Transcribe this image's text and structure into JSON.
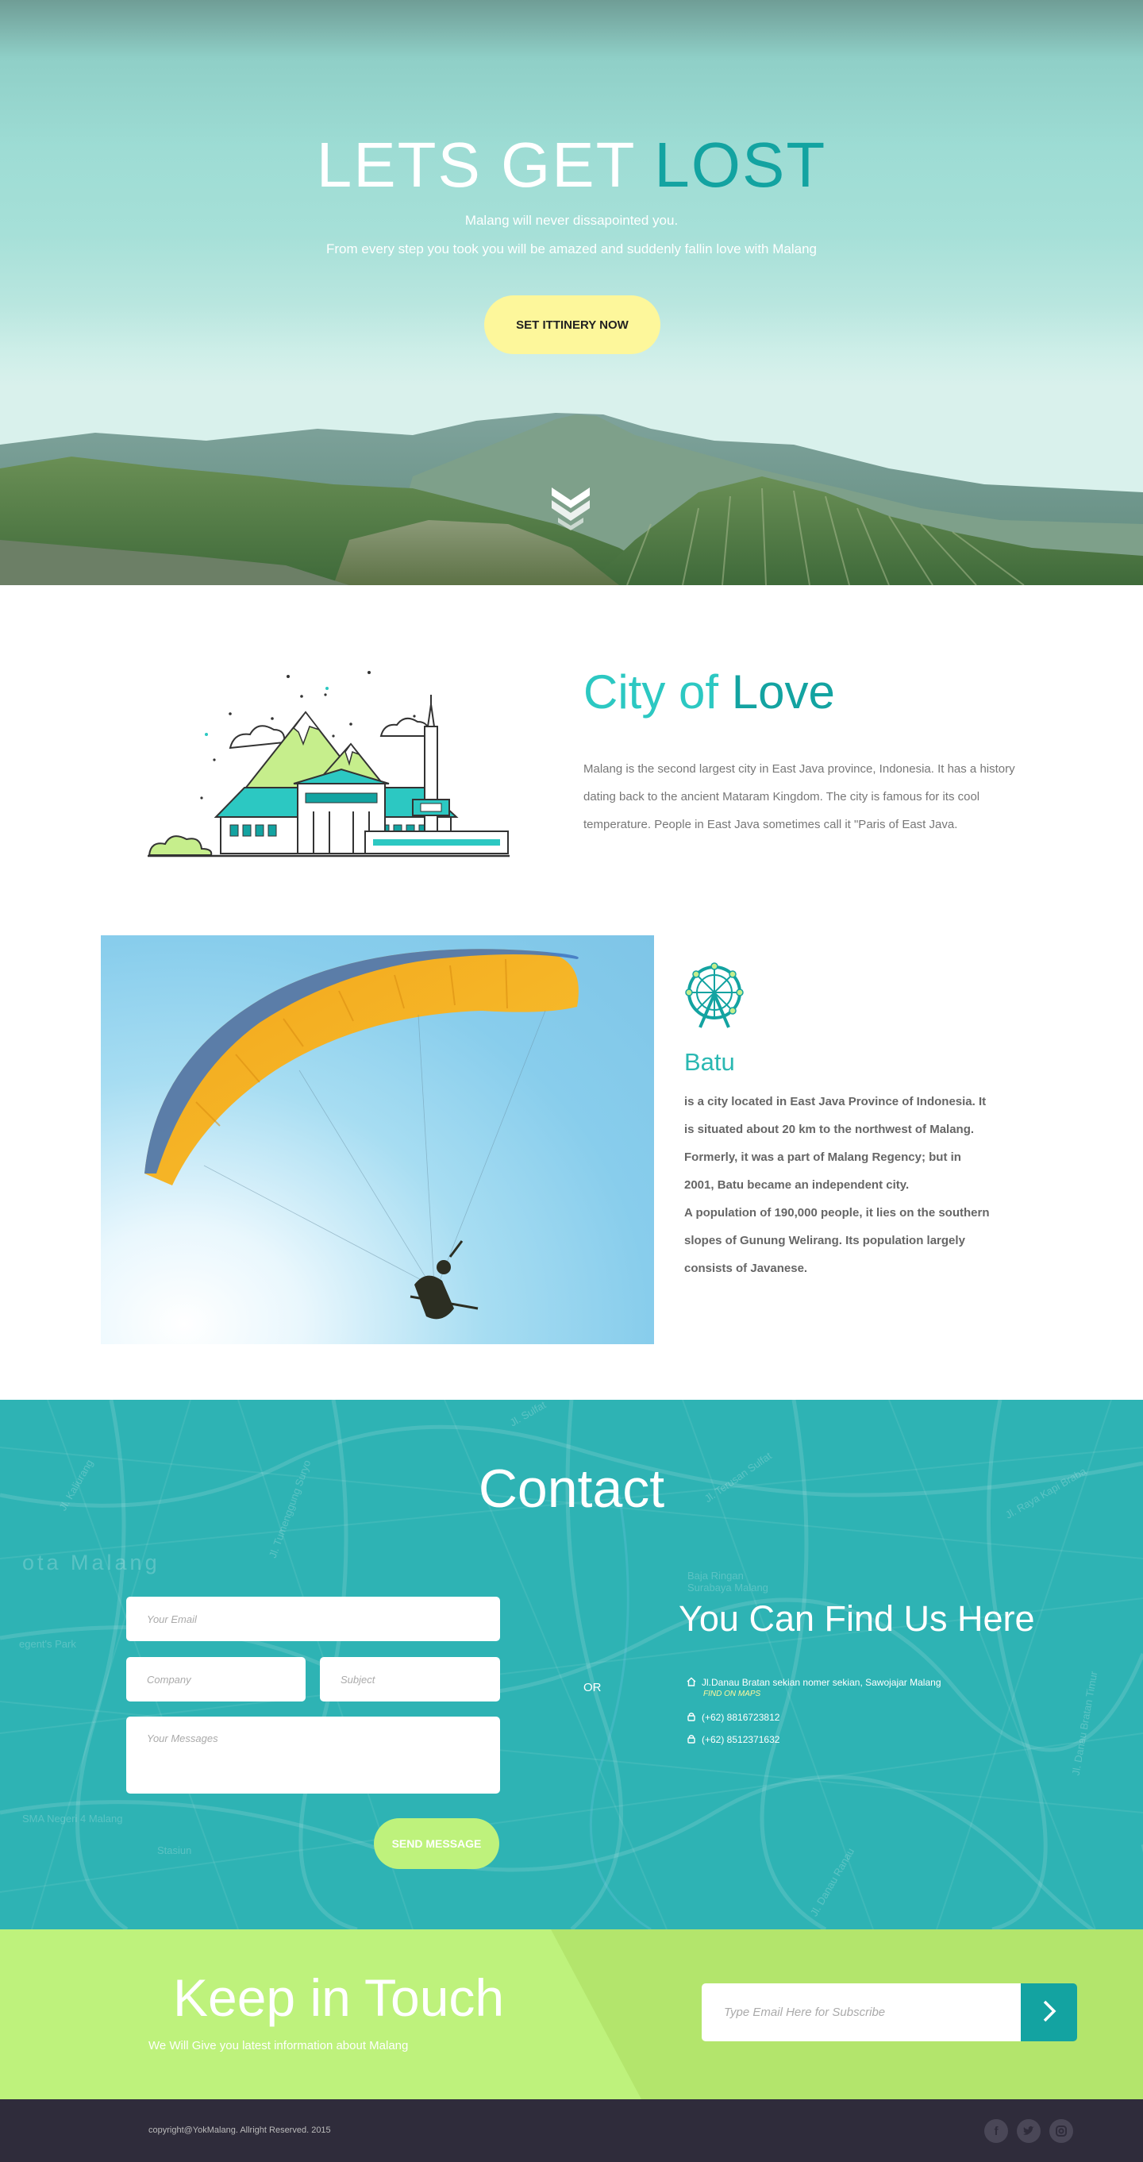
{
  "hero": {
    "title_main": "LETS GET ",
    "title_accent": "LOST",
    "subtitle_1": "Malang will never dissapointed you.",
    "subtitle_2": "From every step you took you will be amazed and suddenly fallin love with Malang",
    "cta_label": "SET ITTINERY NOW"
  },
  "city": {
    "title_prefix": "City of ",
    "title_accent": "Love",
    "description": "Malang is the second largest city in East Java province, Indonesia. It has a history dating back to the ancient Mataram Kingdom. The city is famous for its cool temperature. People in East Java sometimes call it \"Paris of East Java."
  },
  "batu": {
    "title": "Batu",
    "paragraph_1": " is a city located in East Java Province of Indonesia. It is situated about 20 km to the northwest of Malang. Formerly, it was a part of Malang Regency; but in 2001, Batu became an independent city.",
    "paragraph_2": "A population of 190,000 people, it lies on the southern slopes of Gunung Welirang. Its population largely consists of Javanese."
  },
  "contact": {
    "title": "Contact",
    "email_placeholder": "Your Email",
    "company_placeholder": "Company",
    "subject_placeholder": "Subject",
    "message_placeholder": "Your Messages",
    "send_label": "SEND MESSAGE",
    "or_label": "OR",
    "find_title": "You Can Find Us Here",
    "address": "Jl.Danau Bratan sekian nomer sekian, Sawojajar Malang",
    "find_on_maps": "FIND ON MAPS",
    "phone_1": "(+62) 8816723812",
    "phone_2": "(+62) 8512371632",
    "map_labels": {
      "kota": "ota Malang",
      "regent": "egent's Park",
      "sma": "SMA Negeri 4 Malang",
      "stasiun": "Stasiun",
      "baja": "Baja Ringan Surabaya Malang",
      "jl_1": "Jl. Kaliurang",
      "jl_2": "Jl. Sulfat",
      "jl_3": "Jl. Raya Kapi Braba",
      "jl_4": "Jl. Danau Ranau",
      "jl_5": "Jl. Tumenggung Suryo",
      "jl_6": "Jl. Terusan Sulfat",
      "jl_7": "Jl. Danau Bratan Timur"
    }
  },
  "keep": {
    "title": "Keep in Touch",
    "subtitle": "We Will Give you latest information about Malang",
    "input_placeholder": "Type Email Here for Subscribe"
  },
  "footer": {
    "copyright": "copyright@YokMalang. Allright Reserved. 2015"
  },
  "colors": {
    "teal": "#13a3a1",
    "light_teal": "#2cc8c2",
    "contact_bg": "#2eb3b4",
    "lime": "#bef27c",
    "yellow": "#fdf79b",
    "footer_bg": "#2f2c3b"
  },
  "icons": [
    "chevron-down-icon",
    "home-icon",
    "phone-icon",
    "ferris-wheel-icon",
    "arrow-right-icon",
    "facebook-icon",
    "twitter-icon",
    "instagram-icon"
  ]
}
